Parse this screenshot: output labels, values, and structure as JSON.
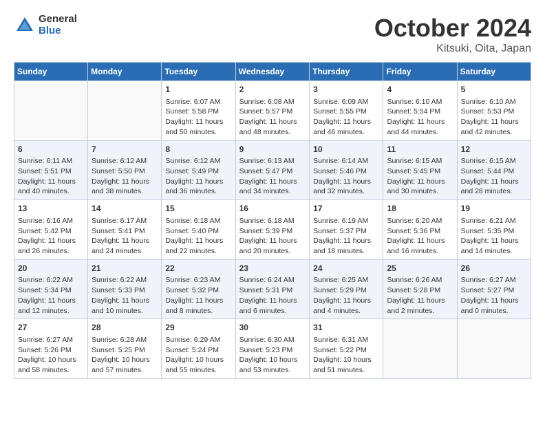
{
  "header": {
    "logo_general": "General",
    "logo_blue": "Blue",
    "month_title": "October 2024",
    "location": "Kitsuki, Oita, Japan"
  },
  "days_of_week": [
    "Sunday",
    "Monday",
    "Tuesday",
    "Wednesday",
    "Thursday",
    "Friday",
    "Saturday"
  ],
  "weeks": [
    [
      {
        "day": "",
        "content": ""
      },
      {
        "day": "",
        "content": ""
      },
      {
        "day": "1",
        "content": "Sunrise: 6:07 AM\nSunset: 5:58 PM\nDaylight: 11 hours and 50 minutes."
      },
      {
        "day": "2",
        "content": "Sunrise: 6:08 AM\nSunset: 5:57 PM\nDaylight: 11 hours and 48 minutes."
      },
      {
        "day": "3",
        "content": "Sunrise: 6:09 AM\nSunset: 5:55 PM\nDaylight: 11 hours and 46 minutes."
      },
      {
        "day": "4",
        "content": "Sunrise: 6:10 AM\nSunset: 5:54 PM\nDaylight: 11 hours and 44 minutes."
      },
      {
        "day": "5",
        "content": "Sunrise: 6:10 AM\nSunset: 5:53 PM\nDaylight: 11 hours and 42 minutes."
      }
    ],
    [
      {
        "day": "6",
        "content": "Sunrise: 6:11 AM\nSunset: 5:51 PM\nDaylight: 11 hours and 40 minutes."
      },
      {
        "day": "7",
        "content": "Sunrise: 6:12 AM\nSunset: 5:50 PM\nDaylight: 11 hours and 38 minutes."
      },
      {
        "day": "8",
        "content": "Sunrise: 6:12 AM\nSunset: 5:49 PM\nDaylight: 11 hours and 36 minutes."
      },
      {
        "day": "9",
        "content": "Sunrise: 6:13 AM\nSunset: 5:47 PM\nDaylight: 11 hours and 34 minutes."
      },
      {
        "day": "10",
        "content": "Sunrise: 6:14 AM\nSunset: 5:46 PM\nDaylight: 11 hours and 32 minutes."
      },
      {
        "day": "11",
        "content": "Sunrise: 6:15 AM\nSunset: 5:45 PM\nDaylight: 11 hours and 30 minutes."
      },
      {
        "day": "12",
        "content": "Sunrise: 6:15 AM\nSunset: 5:44 PM\nDaylight: 11 hours and 28 minutes."
      }
    ],
    [
      {
        "day": "13",
        "content": "Sunrise: 6:16 AM\nSunset: 5:42 PM\nDaylight: 11 hours and 26 minutes."
      },
      {
        "day": "14",
        "content": "Sunrise: 6:17 AM\nSunset: 5:41 PM\nDaylight: 11 hours and 24 minutes."
      },
      {
        "day": "15",
        "content": "Sunrise: 6:18 AM\nSunset: 5:40 PM\nDaylight: 11 hours and 22 minutes."
      },
      {
        "day": "16",
        "content": "Sunrise: 6:18 AM\nSunset: 5:39 PM\nDaylight: 11 hours and 20 minutes."
      },
      {
        "day": "17",
        "content": "Sunrise: 6:19 AM\nSunset: 5:37 PM\nDaylight: 11 hours and 18 minutes."
      },
      {
        "day": "18",
        "content": "Sunrise: 6:20 AM\nSunset: 5:36 PM\nDaylight: 11 hours and 16 minutes."
      },
      {
        "day": "19",
        "content": "Sunrise: 6:21 AM\nSunset: 5:35 PM\nDaylight: 11 hours and 14 minutes."
      }
    ],
    [
      {
        "day": "20",
        "content": "Sunrise: 6:22 AM\nSunset: 5:34 PM\nDaylight: 11 hours and 12 minutes."
      },
      {
        "day": "21",
        "content": "Sunrise: 6:22 AM\nSunset: 5:33 PM\nDaylight: 11 hours and 10 minutes."
      },
      {
        "day": "22",
        "content": "Sunrise: 6:23 AM\nSunset: 5:32 PM\nDaylight: 11 hours and 8 minutes."
      },
      {
        "day": "23",
        "content": "Sunrise: 6:24 AM\nSunset: 5:31 PM\nDaylight: 11 hours and 6 minutes."
      },
      {
        "day": "24",
        "content": "Sunrise: 6:25 AM\nSunset: 5:29 PM\nDaylight: 11 hours and 4 minutes."
      },
      {
        "day": "25",
        "content": "Sunrise: 6:26 AM\nSunset: 5:28 PM\nDaylight: 11 hours and 2 minutes."
      },
      {
        "day": "26",
        "content": "Sunrise: 6:27 AM\nSunset: 5:27 PM\nDaylight: 11 hours and 0 minutes."
      }
    ],
    [
      {
        "day": "27",
        "content": "Sunrise: 6:27 AM\nSunset: 5:26 PM\nDaylight: 10 hours and 58 minutes."
      },
      {
        "day": "28",
        "content": "Sunrise: 6:28 AM\nSunset: 5:25 PM\nDaylight: 10 hours and 57 minutes."
      },
      {
        "day": "29",
        "content": "Sunrise: 6:29 AM\nSunset: 5:24 PM\nDaylight: 10 hours and 55 minutes."
      },
      {
        "day": "30",
        "content": "Sunrise: 6:30 AM\nSunset: 5:23 PM\nDaylight: 10 hours and 53 minutes."
      },
      {
        "day": "31",
        "content": "Sunrise: 6:31 AM\nSunset: 5:22 PM\nDaylight: 10 hours and 51 minutes."
      },
      {
        "day": "",
        "content": ""
      },
      {
        "day": "",
        "content": ""
      }
    ]
  ]
}
